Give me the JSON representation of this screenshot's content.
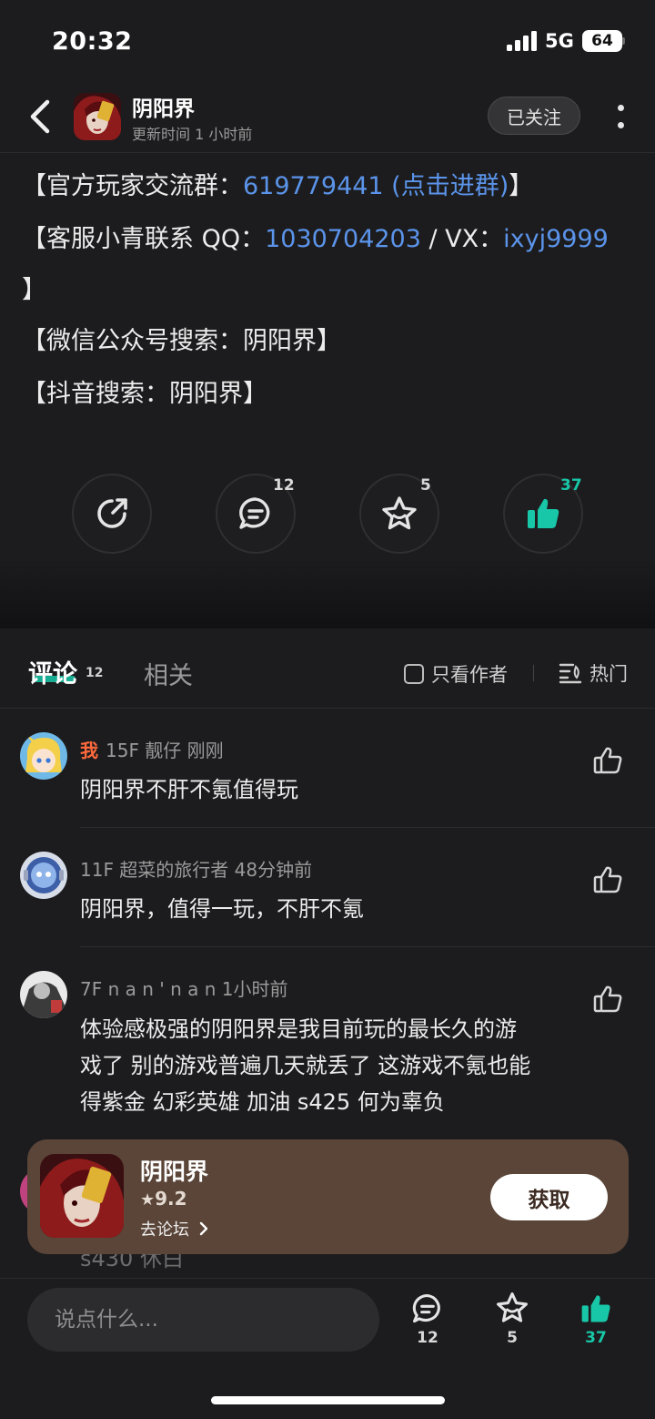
{
  "status_bar": {
    "time": "20:32",
    "network": "5G",
    "battery": "64"
  },
  "header": {
    "title": "阴阳界",
    "subtitle": "更新时间 1 小时前",
    "follow_label": "已关注"
  },
  "article": {
    "line1_prefix": "【官方玩家交流群：",
    "line1_link": "619779441 (点击进群)",
    "line1_suffix": "】",
    "line2_prefix": "【客服小青联系 QQ：",
    "line2_qq": "1030704203",
    "line2_sep": " / VX：",
    "line2_vx": "ixyj9999",
    "line2_end": "】",
    "line3": "【微信公众号搜索：阴阳界】",
    "line4": "【抖音搜索：阴阳界】"
  },
  "actions": {
    "share_count": "",
    "comment_count": "12",
    "favorite_count": "5",
    "like_count": "37"
  },
  "tabs": {
    "comments_label": "评论",
    "comments_count": "12",
    "related_label": "相关",
    "author_only_label": "只看作者",
    "sort_label": "热门"
  },
  "comments": [
    {
      "me_tag": "我",
      "meta": "15F 靓仔   刚刚",
      "text": "阴阳界不肝不氪值得玩"
    },
    {
      "me_tag": "",
      "meta": "11F 超菜的旅行者   48分钟前",
      "text": "阴阳界，值得一玩，不肝不氪"
    },
    {
      "me_tag": "",
      "meta": "7F n a n ' n a n   1小时前",
      "text_lines": [
        "体验感极强的阴阳界是我目前玩的最长久的游",
        "戏了 别的游戏普遍几天就丢了 这游戏不氪也能",
        "得紫金 幻彩英雄 加油  s425 何为辜负"
      ]
    },
    {
      "partial_text": "s430  休白"
    }
  ],
  "app_card": {
    "name": "阴阳界",
    "rating": "9.2",
    "forum_label": "去论坛",
    "get_label": "获取"
  },
  "bottom_bar": {
    "input_placeholder": "说点什么...",
    "comment_count": "12",
    "favorite_count": "5",
    "like_count": "37"
  },
  "colors": {
    "accent": "#18c7a8",
    "link": "#5b94ea",
    "me_tag": "#ff6a3d",
    "card_bg": "#5a4538"
  }
}
